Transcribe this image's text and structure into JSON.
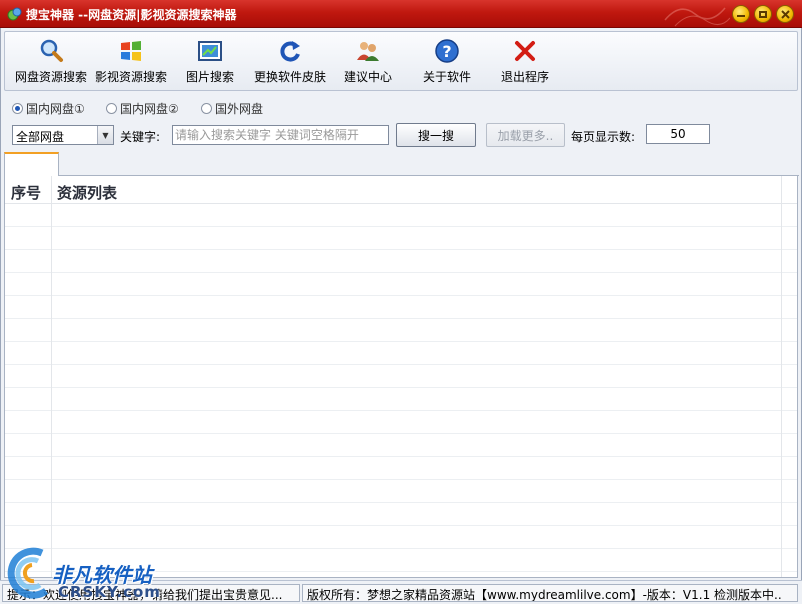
{
  "window": {
    "title": "搜宝神器 --网盘资源|影视资源搜索神器"
  },
  "toolbar": {
    "items": [
      {
        "label": "网盘资源搜索",
        "icon": "magnifier-icon"
      },
      {
        "label": "影视资源搜索",
        "icon": "windows-logo-icon"
      },
      {
        "label": "图片搜索",
        "icon": "picture-icon"
      },
      {
        "label": "更换软件皮肤",
        "icon": "refresh-icon"
      },
      {
        "label": "建议中心",
        "icon": "users-icon"
      },
      {
        "label": "关于软件",
        "icon": "help-icon"
      },
      {
        "label": "退出程序",
        "icon": "exit-x-icon"
      }
    ]
  },
  "source_options": {
    "selected": 0,
    "items": [
      "国内网盘①",
      "国内网盘②",
      "国外网盘"
    ]
  },
  "search": {
    "disk_select_value": "全部网盘",
    "keyword_label": "关键字:",
    "keyword_placeholder": "请输入搜索关键字 关键词空格隔开",
    "search_button": "搜一搜",
    "load_more_button": "加载更多..",
    "per_page_label": "每页显示数:",
    "per_page_value": "50"
  },
  "list": {
    "columns": [
      "序号",
      "资源列表"
    ],
    "rows": []
  },
  "status": {
    "left": "提示：欢迎使用搜宝神器，请给我们提出宝贵意见...",
    "right": "版权所有：梦想之家精品资源站【www.mydreamlilve.com】-版本：V1.1  检测版本中.."
  },
  "watermark": {
    "name": "非凡软件站",
    "site": "CRSKY.com"
  },
  "colors": {
    "titlebar": "#c0180f",
    "accent_tab": "#f2a024",
    "header_text": "#2b2f3a"
  }
}
